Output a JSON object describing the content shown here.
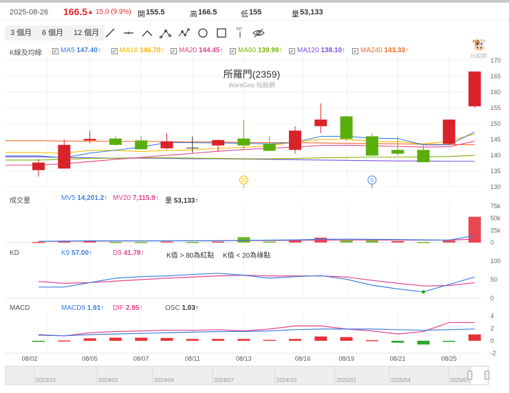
{
  "header": {
    "date": "2025-08-26",
    "price": "166.5",
    "change": "15.0 (9.9%)",
    "open_label": "開",
    "open": "155.5",
    "high_label": "高",
    "high": "166.5",
    "low_label": "低",
    "low": "155",
    "vol_label": "量",
    "vol": "53,133"
  },
  "ranges": [
    "3 個月",
    "6 個月",
    "12 個月"
  ],
  "tools": [
    "line-tool",
    "horizontal-line-tool",
    "angle-tool",
    "abc-pattern-tool",
    "abcd-pattern-tool",
    "circle-tool",
    "rectangle-tool",
    "text-tool",
    "hide-drawings-tool"
  ],
  "watermark": "玩股網",
  "ma_legend": {
    "label": "K線及均線",
    "items": [
      {
        "name": "MA5",
        "value": "147.40↑",
        "color": "#3b7ddd"
      },
      {
        "name": "MA10",
        "value": "146.70↑",
        "color": "#f5b800"
      },
      {
        "name": "MA20",
        "value": "144.45↑",
        "color": "#e0428a"
      },
      {
        "name": "MA60",
        "value": "139.99↑",
        "color": "#7cb305"
      },
      {
        "name": "MA120",
        "value": "138.10↑",
        "color": "#7b4fe0"
      },
      {
        "name": "MA240",
        "value": "143.33↑",
        "color": "#f06a2a"
      }
    ]
  },
  "vol_legend": {
    "label": "成交量",
    "mv5_label": "MV5",
    "mv5": "14,201.2↑",
    "mv20_label": "MV20",
    "mv20": "7,115.9↑",
    "vol_label": "量",
    "vol": "53,133↑"
  },
  "kd_legend": {
    "label": "KD",
    "k_label": "K9",
    "k": "57.00↑",
    "d_label": "D9",
    "d": "41.78↑",
    "note1": "K值 > 80為紅點",
    "note2": "K值 < 20為綠點"
  },
  "macd_legend": {
    "label": "MACD",
    "macd_label": "MACD9",
    "macd": "1.91↑",
    "dif_label": "DIF",
    "dif": "2.95↑",
    "osc_label": "OSC",
    "osc": "1.03↑"
  },
  "colors": {
    "up": "#d9232a",
    "down": "#5aae0c",
    "accent": "#e0262c"
  },
  "chart_data": {
    "type": "candlestick",
    "title": "所羅門(2359)",
    "subtitle": "WantGoo 玩股網",
    "price_ticks": [
      130,
      135,
      140,
      145,
      150,
      155,
      160,
      165,
      170
    ],
    "ylim": [
      130,
      170
    ],
    "x_labels": [
      {
        "i": -0.35,
        "t": "08/02"
      },
      {
        "i": 2,
        "t": "08/05"
      },
      {
        "i": 4,
        "t": "08/07"
      },
      {
        "i": 6,
        "t": "08/11"
      },
      {
        "i": 8,
        "t": "08/13"
      },
      {
        "i": 10.3,
        "t": "08/16"
      },
      {
        "i": 12,
        "t": "08/19"
      },
      {
        "i": 14,
        "t": "08/21"
      },
      {
        "i": 16,
        "t": "08/25"
      }
    ],
    "candles": [
      [
        135.3,
        137.7,
        138.8,
        133.2
      ],
      [
        135.8,
        143.3,
        145,
        135.8
      ],
      [
        144.7,
        145.2,
        147.8,
        143.8
      ],
      [
        145.3,
        143.3,
        146,
        143
      ],
      [
        144.7,
        141.9,
        146,
        141.9
      ],
      [
        142.2,
        144.4,
        147,
        141.8
      ],
      [
        142.4,
        142.4,
        146,
        140.8
      ],
      [
        143.1,
        144.8,
        145,
        141
      ],
      [
        145.3,
        143.1,
        151.3,
        141.9
      ],
      [
        143.6,
        141.4,
        146,
        141.4
      ],
      [
        141.7,
        147.8,
        149.2,
        140.5
      ],
      [
        149.2,
        151.3,
        156.4,
        147
      ],
      [
        152.3,
        145.2,
        152.5,
        144.6
      ],
      [
        146,
        139.9,
        146.9,
        139.9
      ],
      [
        141.7,
        140.5,
        146,
        140
      ],
      [
        141.7,
        137.8,
        143.6,
        137.8
      ],
      [
        143.6,
        151.3,
        151.3,
        143.3
      ],
      [
        155.5,
        166.5,
        166.5,
        155
      ]
    ],
    "ma": {
      "MA5": [
        139.8,
        139.2,
        140.7,
        141.6,
        142.6,
        144,
        144,
        143.9,
        143.8,
        143.6,
        144.1,
        146,
        146,
        145.4,
        145.3,
        143.3,
        143.3,
        147.4
      ],
      "MA10": [
        140.9,
        140.6,
        141.6,
        141.5,
        141.2,
        141.5,
        141.7,
        142.2,
        142.5,
        143,
        144.2,
        145,
        145,
        144.4,
        144.3,
        143.6,
        144.5,
        146.7
      ],
      "MA20": [
        136.9,
        137.3,
        138,
        138.7,
        139.3,
        140,
        140.6,
        141.3,
        141.8,
        142.2,
        142.6,
        143.1,
        143.2,
        143,
        142.8,
        142.6,
        142.7,
        144.45
      ],
      "MA60": [
        138.5,
        138.7,
        139,
        139.1,
        139.2,
        139.2,
        139.1,
        139,
        138.9,
        138.9,
        139,
        139.2,
        139.3,
        139.4,
        139.4,
        139.5,
        139.6,
        139.99
      ],
      "MA120": [
        139.5,
        139.3,
        139.2,
        139.1,
        139.1,
        139,
        138.9,
        138.9,
        138.8,
        138.7,
        138.6,
        138.5,
        138.4,
        138.3,
        138.2,
        138.2,
        138.1,
        138.1
      ],
      "MA240": [
        144.6,
        144.5,
        144.5,
        144.4,
        144.4,
        144.3,
        144.2,
        144.2,
        144.1,
        144,
        144,
        143.9,
        143.8,
        143.7,
        143.6,
        143.5,
        143.4,
        143.33
      ]
    },
    "markers": [
      {
        "i": 8,
        "t": "10",
        "color": "#f5b800"
      },
      {
        "i": 13,
        "t": "5",
        "color": "#3b7ddd"
      }
    ],
    "volume": {
      "ticks": [
        "0",
        "25k",
        "50k",
        "75k"
      ],
      "ymax": 75,
      "values": [
        1,
        2,
        4,
        1,
        1,
        2,
        1,
        2,
        11,
        2,
        5,
        10,
        4,
        4,
        3,
        1,
        4,
        53.1
      ],
      "up": [
        1,
        1,
        1,
        0,
        0,
        1,
        0,
        1,
        0,
        0,
        1,
        1,
        0,
        0,
        1,
        0,
        1,
        1
      ],
      "mv5": [
        2.5,
        3,
        3.5,
        3.5,
        3.5,
        3.5,
        3.5,
        3.5,
        4.5,
        5,
        5.5,
        6.5,
        7,
        6.5,
        6,
        5.5,
        5,
        14.2
      ],
      "mv20": [
        2.5,
        2.8,
        3,
        3.2,
        3.4,
        3.6,
        3.7,
        3.8,
        4,
        4.2,
        4.5,
        5,
        5.2,
        5.2,
        5.1,
        5,
        5,
        7.1
      ]
    },
    "kd": {
      "ticks": [
        "0",
        "50",
        "100"
      ],
      "K": [
        30,
        30,
        42,
        54,
        58,
        60,
        64,
        67,
        62,
        54,
        58,
        61,
        51,
        35,
        25,
        17,
        37,
        57
      ],
      "D": [
        45,
        40,
        42,
        46,
        50,
        54,
        57,
        60,
        62,
        60,
        60,
        60,
        57,
        48,
        40,
        33,
        34,
        41.78
      ],
      "green_dot": 15
    },
    "macd": {
      "ticks": [
        "-2",
        "0",
        "2",
        "4"
      ],
      "ylim": [
        -2,
        4
      ],
      "DIF": [
        1,
        0.8,
        1.3,
        1.5,
        1.6,
        1.7,
        1.7,
        1.8,
        1.6,
        1.9,
        2.4,
        2.4,
        1.9,
        1.6,
        1.1,
        1.5,
        2.95,
        2.95
      ],
      "MACD9": [
        0.9,
        0.8,
        1,
        1.1,
        1.2,
        1.3,
        1.4,
        1.5,
        1.5,
        1.6,
        1.8,
        1.9,
        1.9,
        1.9,
        1.8,
        1.7,
        1.8,
        1.91
      ],
      "OSC": [
        -0.1,
        0.05,
        0.4,
        0.5,
        0.5,
        0.45,
        0.3,
        0.3,
        0.3,
        0.15,
        0.3,
        0.7,
        0.6,
        0.1,
        -0.3,
        -0.6,
        -0.1,
        1.03
      ]
    },
    "navigator": [
      "2023/10",
      "2024/01",
      "2024/04",
      "2024/07",
      "2024/10",
      "2025/01",
      "2025/04",
      "2025/07"
    ]
  }
}
